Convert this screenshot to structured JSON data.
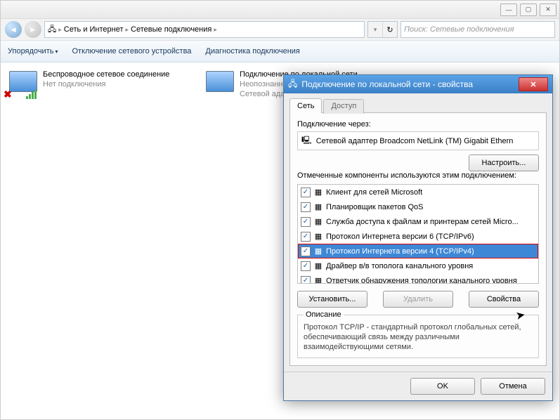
{
  "window": {
    "breadcrumb": [
      "Сеть и Интернет",
      "Сетевые подключения"
    ],
    "search_placeholder": "Поиск: Сетевые подключения"
  },
  "toolbar": {
    "organize": "Упорядочить",
    "disable": "Отключение сетевого устройства",
    "diagnose": "Диагностика подключения"
  },
  "connections": [
    {
      "name": "Беспроводное сетевое соединение",
      "status": "Нет подключения",
      "type": "wifi"
    },
    {
      "name": "Подключение по локальной сети",
      "status": "Неопознанная сеть",
      "adapter": "Сетевой адаптер",
      "type": "lan"
    }
  ],
  "dialog": {
    "title": "Подключение по локальной сети - свойства",
    "tabs": [
      "Сеть",
      "Доступ"
    ],
    "connect_using_label": "Подключение через:",
    "adapter": "Сетевой адаптер Broadcom NetLink (TM) Gigabit Ethern",
    "configure": "Настроить...",
    "components_label": "Отмеченные компоненты используются этим подключением:",
    "items": [
      {
        "checked": true,
        "label": "Клиент для сетей Microsoft"
      },
      {
        "checked": true,
        "label": "Планировщик пакетов QoS"
      },
      {
        "checked": true,
        "label": "Служба доступа к файлам и принтерам сетей Micro..."
      },
      {
        "checked": true,
        "label": "Протокол Интернета версии 6 (TCP/IPv6)"
      },
      {
        "checked": true,
        "label": "Протокол Интернета версии 4 (TCP/IPv4)",
        "selected": true
      },
      {
        "checked": true,
        "label": "Драйвер в/в тополога канального уровня"
      },
      {
        "checked": true,
        "label": "Ответчик обнаружения топологии канального уровня"
      }
    ],
    "install": "Установить...",
    "uninstall": "Удалить",
    "properties": "Свойства",
    "desc_title": "Описание",
    "desc_text": "Протокол TCP/IP - стандартный протокол глобальных сетей, обеспечивающий связь между различными взаимодействующими сетями.",
    "ok": "OK",
    "cancel": "Отмена"
  }
}
